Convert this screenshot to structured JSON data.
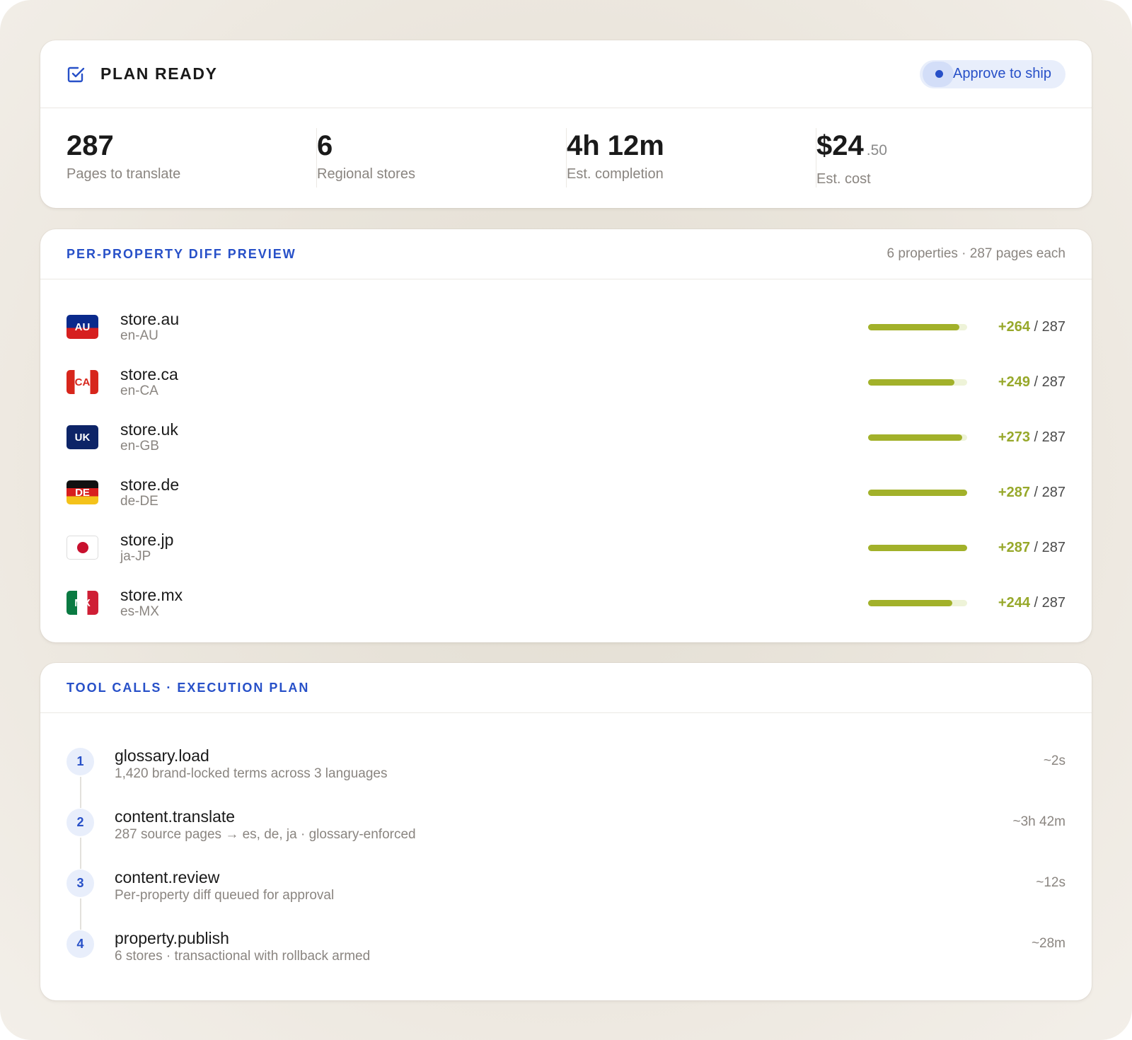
{
  "plan": {
    "title": "PLAN READY",
    "approve_label": "Approve to ship",
    "stats": [
      {
        "value": "287",
        "label": "Pages to translate"
      },
      {
        "value": "6",
        "label": "Regional stores"
      },
      {
        "value": "4h 12m",
        "label": "Est. completion"
      },
      {
        "value": "$24",
        "cents": ".50",
        "label": "Est. cost"
      }
    ]
  },
  "diff": {
    "title": "PER-PROPERTY DIFF PREVIEW",
    "meta": "6 properties · 287 pages each",
    "total": 287,
    "properties": [
      {
        "flag": "AU",
        "name": "store.au",
        "locale": "en-AU",
        "delta": "+264",
        "total": "/ 287",
        "progress": 0.92
      },
      {
        "flag": "CA",
        "name": "store.ca",
        "locale": "en-CA",
        "delta": "+249",
        "total": "/ 287",
        "progress": 0.868
      },
      {
        "flag": "UK",
        "name": "store.uk",
        "locale": "en-GB",
        "delta": "+273",
        "total": "/ 287",
        "progress": 0.951
      },
      {
        "flag": "DE",
        "name": "store.de",
        "locale": "de-DE",
        "delta": "+287",
        "total": "/ 287",
        "progress": 1.0
      },
      {
        "flag": "",
        "name": "store.jp",
        "locale": "ja-JP",
        "delta": "+287",
        "total": "/ 287",
        "progress": 1.0
      },
      {
        "flag": "MX",
        "name": "store.mx",
        "locale": "es-MX",
        "delta": "+244",
        "total": "/ 287",
        "progress": 0.85
      }
    ]
  },
  "tools": {
    "title": "TOOL CALLS · EXECUTION PLAN",
    "steps": [
      {
        "num": "1",
        "name": "glossary.load",
        "desc": "1,420 brand-locked terms across 3 languages",
        "time": "~2s"
      },
      {
        "num": "2",
        "name": "content.translate",
        "desc": "287 source pages → es, de, ja · glossary-enforced",
        "time": "~3h 42m"
      },
      {
        "num": "3",
        "name": "content.review",
        "desc": "Per-property diff queued for approval",
        "time": "~12s"
      },
      {
        "num": "4",
        "name": "property.publish",
        "desc": "6 stores · transactional with rollback armed",
        "time": "~28m"
      }
    ]
  },
  "colors": {
    "accent": "#2750c8",
    "progress": "#a2b12a",
    "delta": "#97a82a"
  }
}
